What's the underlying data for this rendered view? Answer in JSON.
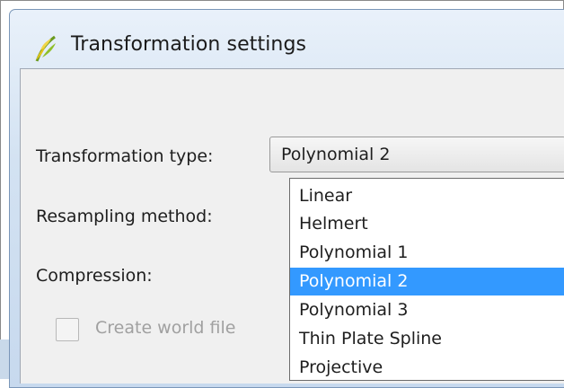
{
  "window": {
    "title": "Transformation settings",
    "icon": "qgis-logo-icon"
  },
  "form": {
    "transformation_type_label": "Transformation type:",
    "transformation_type_value": "Polynomial 2",
    "resampling_method_label": "Resampling method:",
    "compression_label": "Compression:",
    "create_world_file_label": "Create world file",
    "create_world_file_checked": false
  },
  "dropdown": {
    "options": [
      {
        "label": "Linear",
        "selected": false
      },
      {
        "label": "Helmert",
        "selected": false
      },
      {
        "label": "Polynomial 1",
        "selected": false
      },
      {
        "label": "Polynomial 2",
        "selected": true
      },
      {
        "label": "Polynomial 3",
        "selected": false
      },
      {
        "label": "Thin Plate Spline",
        "selected": false
      },
      {
        "label": "Projective",
        "selected": false
      }
    ]
  },
  "colors": {
    "selection": "#3399ff",
    "title_bar": "#d3e2f2",
    "disabled_text": "#a0a0a0"
  }
}
